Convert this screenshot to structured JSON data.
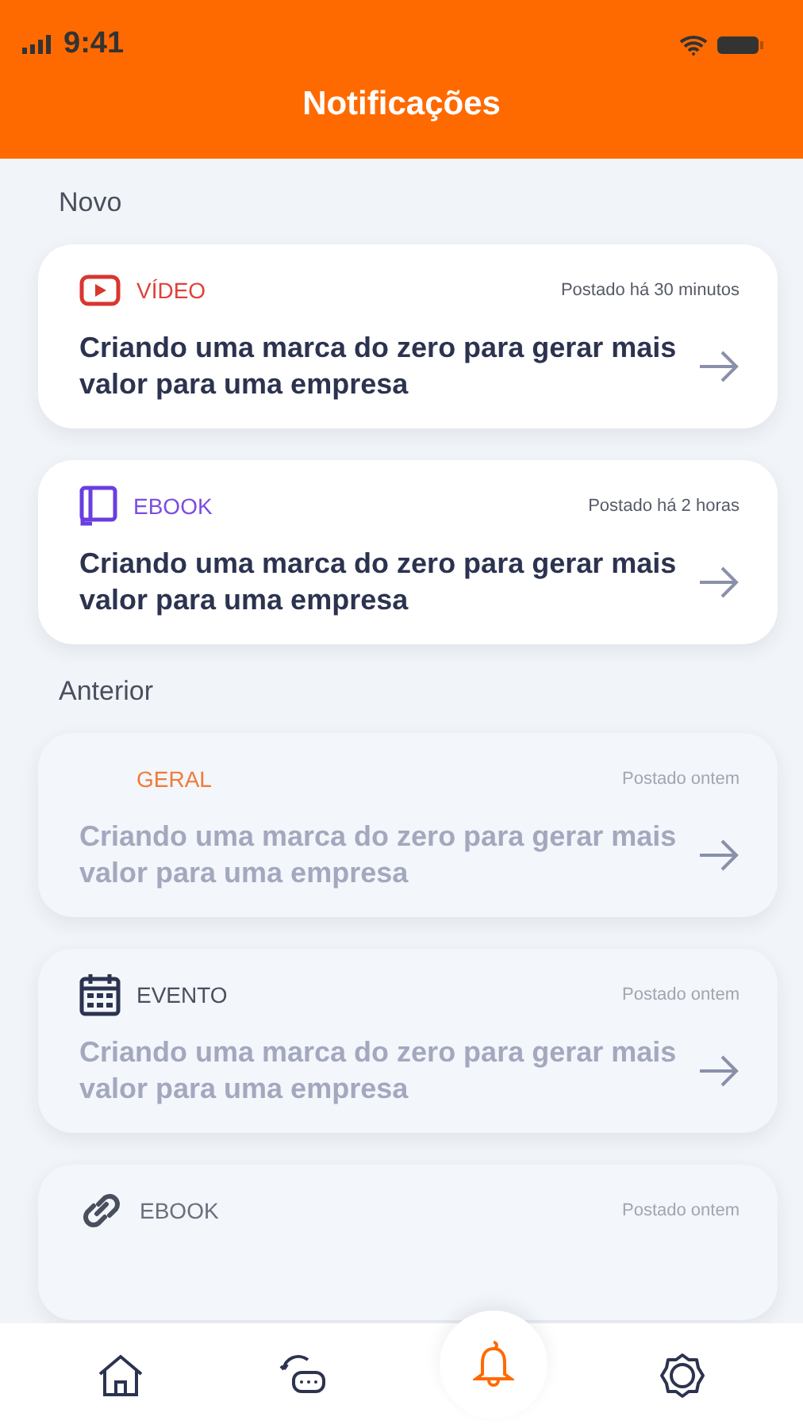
{
  "status_bar": {
    "time": "9:41"
  },
  "header": {
    "title": "Notificações"
  },
  "sections": [
    {
      "title": "Novo",
      "items": [
        {
          "kind": "video",
          "category": "VÍDEO",
          "color": "#e0413a",
          "posted": "Postado há 30 minutos",
          "title": "Criando uma marca do zero para gerar mais valor para uma empresa",
          "read": false
        },
        {
          "kind": "ebook",
          "category": "EBOOK",
          "color": "#7b4de0",
          "posted": "Postado há 2 horas",
          "title": "Criando uma marca do zero para gerar mais valor para uma empresa",
          "read": false
        }
      ]
    },
    {
      "title": "Anterior",
      "items": [
        {
          "kind": "general",
          "category": "GERAL",
          "color": "#f07a3a",
          "posted": "Postado ontem",
          "title": "Criando uma marca do zero para gerar mais valor para uma empresa",
          "read": true
        },
        {
          "kind": "event",
          "category": "EVENTO",
          "color": "#4a4f5e",
          "posted": "Postado ontem",
          "title": "Criando uma marca do zero para gerar mais valor para uma empresa",
          "read": true
        },
        {
          "kind": "link",
          "category": "EBOOK",
          "color": "#6a6f7e",
          "posted": "Postado ontem",
          "read": true
        }
      ]
    }
  ],
  "nav": [
    {
      "kind": "home",
      "selected": false
    },
    {
      "kind": "chat",
      "selected": false
    },
    {
      "kind": "bell",
      "selected": true
    },
    {
      "kind": "settings",
      "selected": false
    }
  ]
}
